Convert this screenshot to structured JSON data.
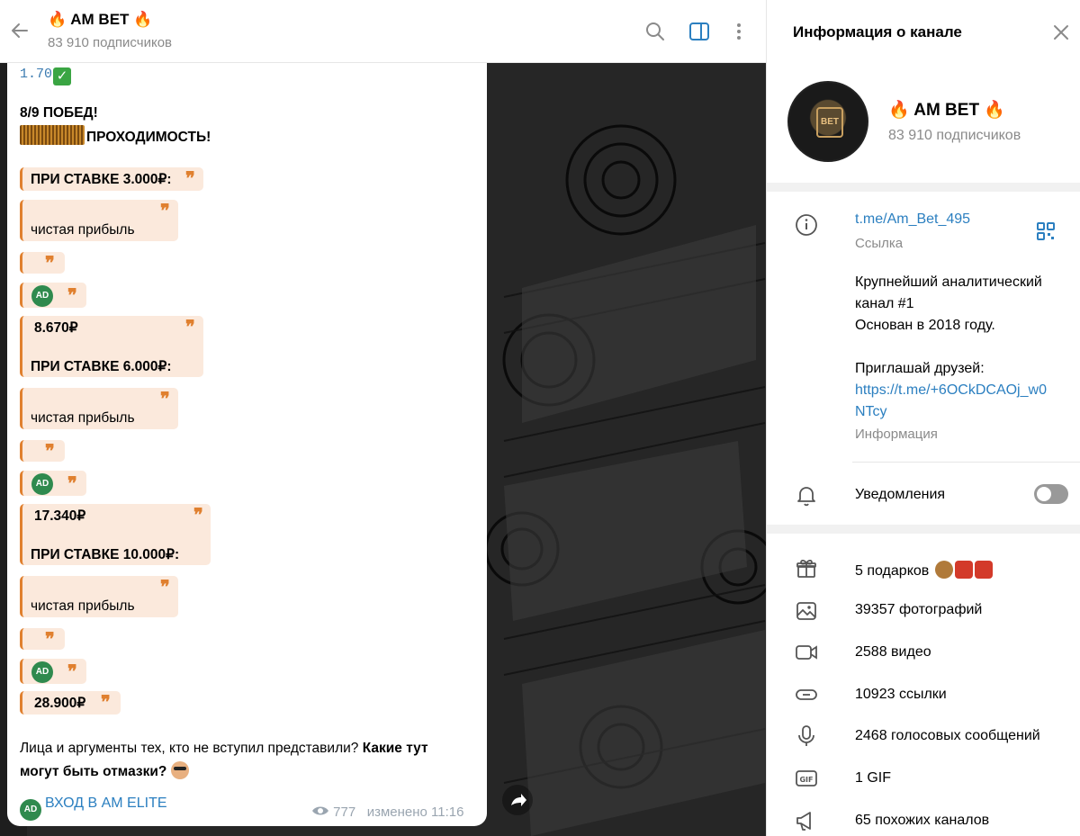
{
  "chat": {
    "title": "🔥 AM BET 🔥",
    "subtitle": "83 910 подписчиков",
    "message": {
      "top_odds": "1.70",
      "wins": "8/9 ПОБЕД!",
      "passability": "ПРОХОДИМОСТЬ!",
      "stake_3000": "ПРИ СТАВКЕ 3.000₽:",
      "net_profit": "чистая прибыль",
      "amount_1": "8.670₽",
      "stake_6000": "ПРИ СТАВКЕ 6.000₽:",
      "amount_2": "17.340₽",
      "stake_10000": "ПРИ СТАВКЕ 10.000₽:",
      "amount_3": "28.900₽",
      "closing_plain": "Лица и аргументы тех, кто не вступил представили?",
      "closing_bold_1": "Какие тут",
      "closing_bold_2": "могут быть отмазки?",
      "button_label": "ВХОД В AM ELITE",
      "views": "777",
      "edited": "изменено 11:16",
      "quote_mark": "❞",
      "logo_text": "AD"
    }
  },
  "info_panel": {
    "header_title": "Информация о канале",
    "channel_name": "🔥 AM BET 🔥",
    "subscribers": "83 910 подписчиков",
    "avatar_text": "BET",
    "link": "t.me/Am_Bet_495",
    "link_label": "Ссылка",
    "description_line1": "Крупнейший аналитический",
    "description_line2": "канал #1",
    "description_line3": "Основан в 2018 году.",
    "invite_line": "Приглашай друзей:",
    "invite_link_1": "https://t.me/+6OCkDCAOj_w0",
    "invite_link_2": "NTcy",
    "info_label": "Информация",
    "notifications_label": "Уведомления",
    "notifications_enabled": false,
    "media": [
      {
        "icon": "gift-icon",
        "label": "5 подарков"
      },
      {
        "icon": "photo-icon",
        "label": "39357 фотографий"
      },
      {
        "icon": "video-icon",
        "label": "2588 видео"
      },
      {
        "icon": "link-icon",
        "label": "10923 ссылки"
      },
      {
        "icon": "microphone-icon",
        "label": "2468 голосовых сообщений"
      },
      {
        "icon": "gif-icon",
        "label": "1 GIF"
      },
      {
        "icon": "megaphone-icon",
        "label": "65 похожих каналов"
      }
    ]
  },
  "colors": {
    "accent": "#2b7fc0",
    "quote_bg": "#fbe9dc",
    "quote_border": "#e0802f",
    "check_green": "#3aa543"
  }
}
